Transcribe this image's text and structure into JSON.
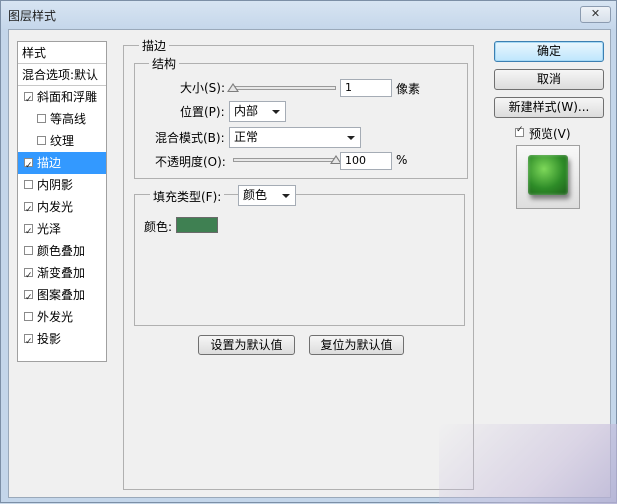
{
  "window": {
    "title": "图层样式",
    "close_glyph": "✕"
  },
  "styles_list": {
    "items": [
      {
        "label": "样式",
        "kind": "header"
      },
      {
        "label": "混合选项:默认",
        "kind": "header"
      },
      {
        "label": "斜面和浮雕",
        "checked": true,
        "indent": 0
      },
      {
        "label": "等高线",
        "checked": false,
        "indent": 1
      },
      {
        "label": "纹理",
        "checked": false,
        "indent": 1
      },
      {
        "label": "描边",
        "checked": true,
        "indent": 0,
        "selected": true
      },
      {
        "label": "内阴影",
        "checked": false,
        "indent": 0
      },
      {
        "label": "内发光",
        "checked": true,
        "indent": 0
      },
      {
        "label": "光泽",
        "checked": true,
        "indent": 0
      },
      {
        "label": "颜色叠加",
        "checked": false,
        "indent": 0
      },
      {
        "label": "渐变叠加",
        "checked": true,
        "indent": 0
      },
      {
        "label": "图案叠加",
        "checked": true,
        "indent": 0
      },
      {
        "label": "外发光",
        "checked": false,
        "indent": 0
      },
      {
        "label": "投影",
        "checked": true,
        "indent": 0
      }
    ]
  },
  "stroke": {
    "group_title": "描边",
    "structure": {
      "title": "结构",
      "size_label": "大小(S):",
      "size_value": "1",
      "size_unit": "像素",
      "size_slider_fraction": 0.0,
      "position_label": "位置(P):",
      "position_value": "内部",
      "blend_label": "混合模式(B):",
      "blend_value": "正常",
      "opacity_label": "不透明度(O):",
      "opacity_value": "100",
      "opacity_unit": "%",
      "opacity_slider_fraction": 1.0
    },
    "fill": {
      "type_label": "填充类型(F):",
      "type_value": "颜色",
      "color_label": "颜色:",
      "color": "#3f8052"
    },
    "reset_buttons": {
      "make_default": "设置为默认值",
      "reset_default": "复位为默认值"
    }
  },
  "actions": {
    "ok": "确定",
    "cancel": "取消",
    "new_style": "新建样式(W)...",
    "preview_label": "预览(V)",
    "preview_checked": true
  }
}
